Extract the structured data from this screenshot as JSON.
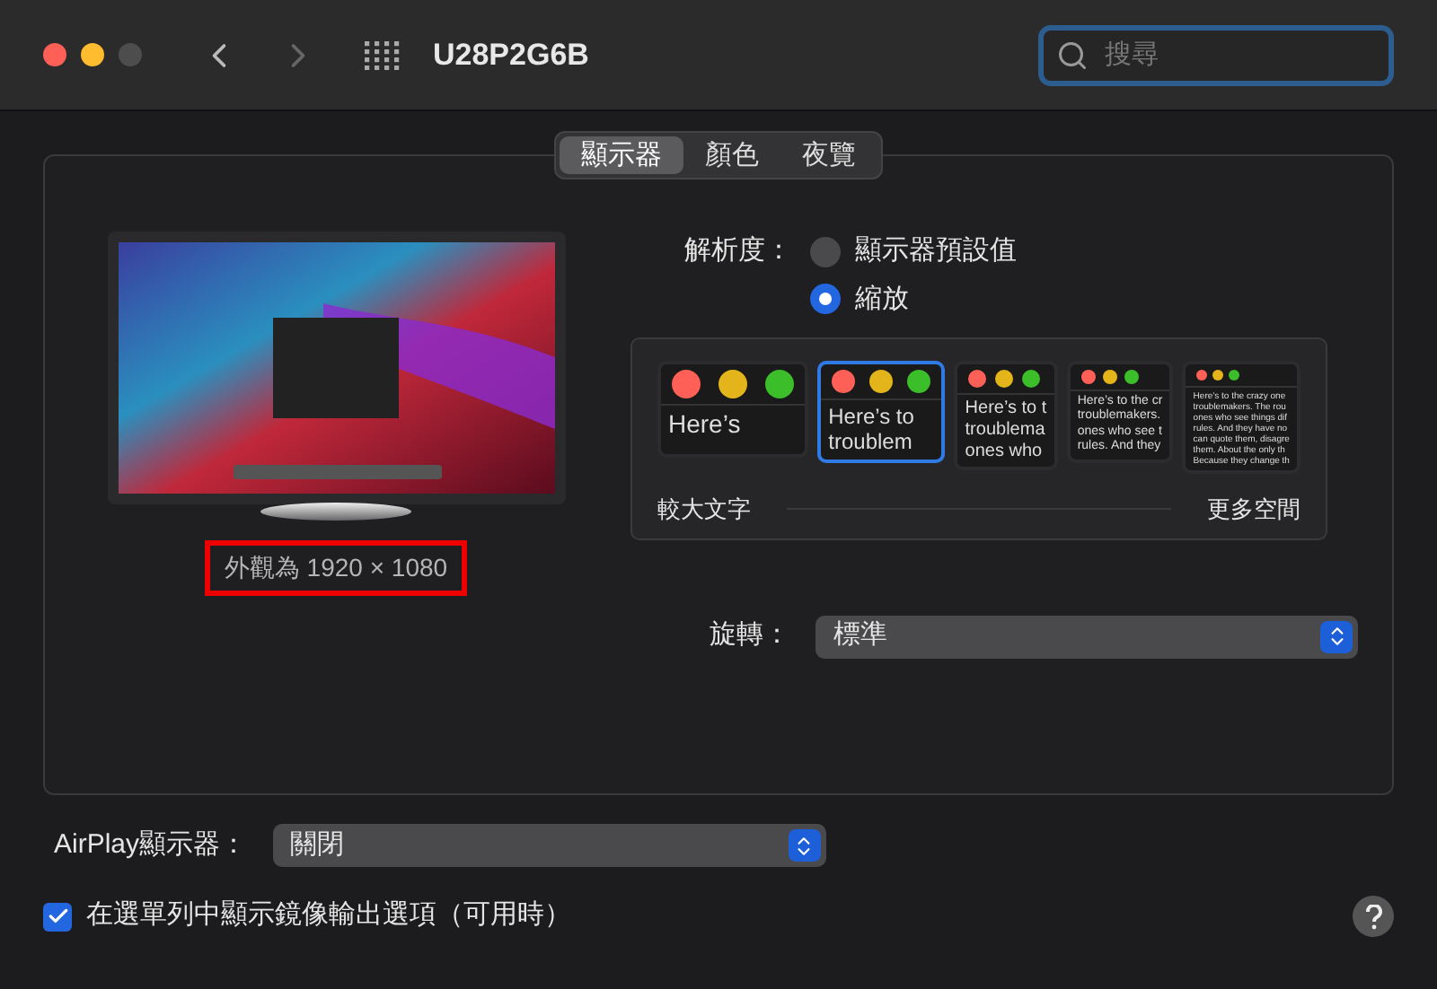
{
  "window": {
    "title": "U28P2G6B"
  },
  "search": {
    "placeholder": "搜尋"
  },
  "tabs": [
    {
      "label": "顯示器",
      "selected": true
    },
    {
      "label": "顏色",
      "selected": false
    },
    {
      "label": "夜覽",
      "selected": false
    }
  ],
  "preview": {
    "caption": "外觀為 1920 × 1080"
  },
  "resolution": {
    "label": "解析度：",
    "options": [
      {
        "label": "顯示器預設值",
        "selected": false
      },
      {
        "label": "縮放",
        "selected": true
      }
    ]
  },
  "scale_options": [
    {
      "selected": false,
      "lines": [
        "Here’s"
      ]
    },
    {
      "selected": true,
      "lines": [
        "Here’s to",
        "troublem"
      ]
    },
    {
      "selected": false,
      "lines": [
        "Here’s to t",
        "troublema",
        "ones who"
      ]
    },
    {
      "selected": false,
      "lines": [
        "Here’s to the cr",
        "troublemakers.",
        "ones who see t",
        "rules. And they"
      ]
    },
    {
      "selected": false,
      "lines": [
        "Here’s to the crazy one",
        "troublemakers. The rou",
        "ones who see things dif",
        "rules. And they have no",
        "can quote them, disagre",
        "them. About the only th",
        "Because they change th"
      ]
    }
  ],
  "scale_labels": {
    "left": "較大文字",
    "right": "更多空間"
  },
  "rotation": {
    "label": "旋轉：",
    "value": "標準"
  },
  "airplay": {
    "label": "AirPlay顯示器：",
    "value": "關閉"
  },
  "mirror_option": {
    "label": "在選單列中顯示鏡像輸出選項（可用時）",
    "checked": true
  }
}
